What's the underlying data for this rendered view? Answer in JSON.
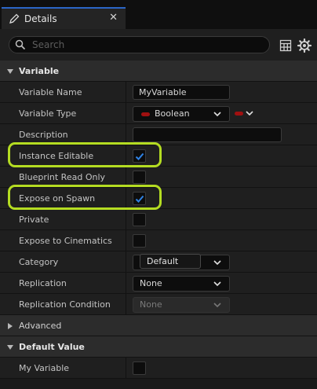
{
  "tab": {
    "title": "Details",
    "close_glyph": "✕",
    "icon": "pencil-icon"
  },
  "search": {
    "placeholder": "Search",
    "value": ""
  },
  "toolbar": {
    "grid_icon": "table-view-icon",
    "settings_icon": "gear-icon"
  },
  "sections": {
    "variable": {
      "label": "Variable",
      "expanded": true,
      "properties": {
        "variable_name": {
          "label": "Variable Name",
          "value": "MyVariable"
        },
        "variable_type": {
          "label": "Variable Type",
          "value": "Boolean",
          "type_color": "#a01010"
        },
        "description": {
          "label": "Description",
          "value": ""
        },
        "instance_editable": {
          "label": "Instance Editable",
          "checked": true
        },
        "blueprint_read_only": {
          "label": "Blueprint Read Only",
          "checked": false
        },
        "expose_on_spawn": {
          "label": "Expose on Spawn",
          "checked": true
        },
        "private": {
          "label": "Private",
          "checked": false
        },
        "expose_to_cinematics": {
          "label": "Expose to Cinematics",
          "checked": false
        },
        "category": {
          "label": "Category",
          "value": "Default"
        },
        "replication": {
          "label": "Replication",
          "value": "None"
        },
        "replication_condition": {
          "label": "Replication Condition",
          "value": "None",
          "disabled": true
        }
      }
    },
    "advanced": {
      "label": "Advanced",
      "expanded": false
    },
    "default_value": {
      "label": "Default Value",
      "expanded": true,
      "properties": {
        "my_variable": {
          "label": "My Variable",
          "checked": false
        }
      }
    }
  },
  "colors": {
    "accent": "#2b66c7",
    "highlight": "#b4dc22",
    "check": "#2f83e6",
    "background": "#1f1f1f"
  }
}
